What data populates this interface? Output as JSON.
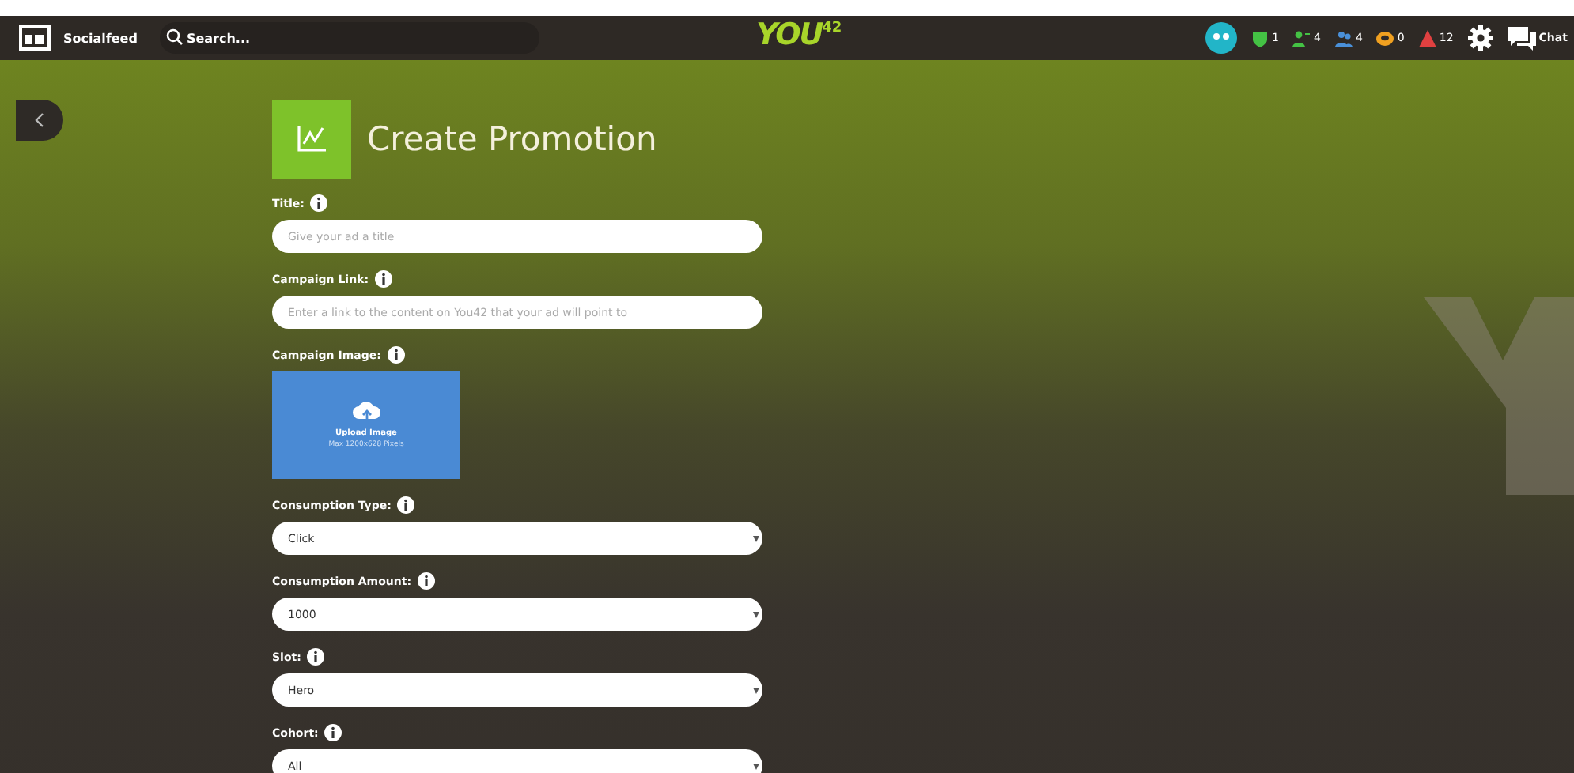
{
  "top_bar": {
    "app_name": "Socialfeed",
    "search": {
      "placeholder": "Search..."
    },
    "logo": {
      "text": "YOU",
      "superscript": "42"
    },
    "counters": [
      {
        "kind": "shield",
        "value": "1",
        "color": "#44c244"
      },
      {
        "kind": "person",
        "value": "4",
        "color": "#44c244"
      },
      {
        "kind": "group",
        "value": "4",
        "color": "#4a90d9"
      },
      {
        "kind": "coin",
        "value": "0",
        "color": "#f0a020"
      },
      {
        "kind": "alert",
        "value": "12",
        "color": "#e04040"
      }
    ],
    "chat_label": "Chat"
  },
  "page": {
    "title": "Create Promotion",
    "fields": [
      {
        "kind": "text",
        "label": "Title:",
        "placeholder": "Give your ad a title"
      },
      {
        "kind": "text",
        "label": "Campaign Link:",
        "placeholder": "Enter a link to the content on You42 that your ad will point to"
      },
      {
        "kind": "image",
        "label": "Campaign Image:",
        "upload_label": "Upload Image",
        "upload_hint": "Max 1200x628 Pixels"
      },
      {
        "kind": "select",
        "label": "Consumption Type:",
        "value": "Click"
      },
      {
        "kind": "select",
        "label": "Consumption Amount:",
        "value": "1000"
      },
      {
        "kind": "select",
        "label": "Slot:",
        "value": "Hero"
      },
      {
        "kind": "select",
        "label": "Cohort:",
        "value": "All"
      }
    ]
  }
}
